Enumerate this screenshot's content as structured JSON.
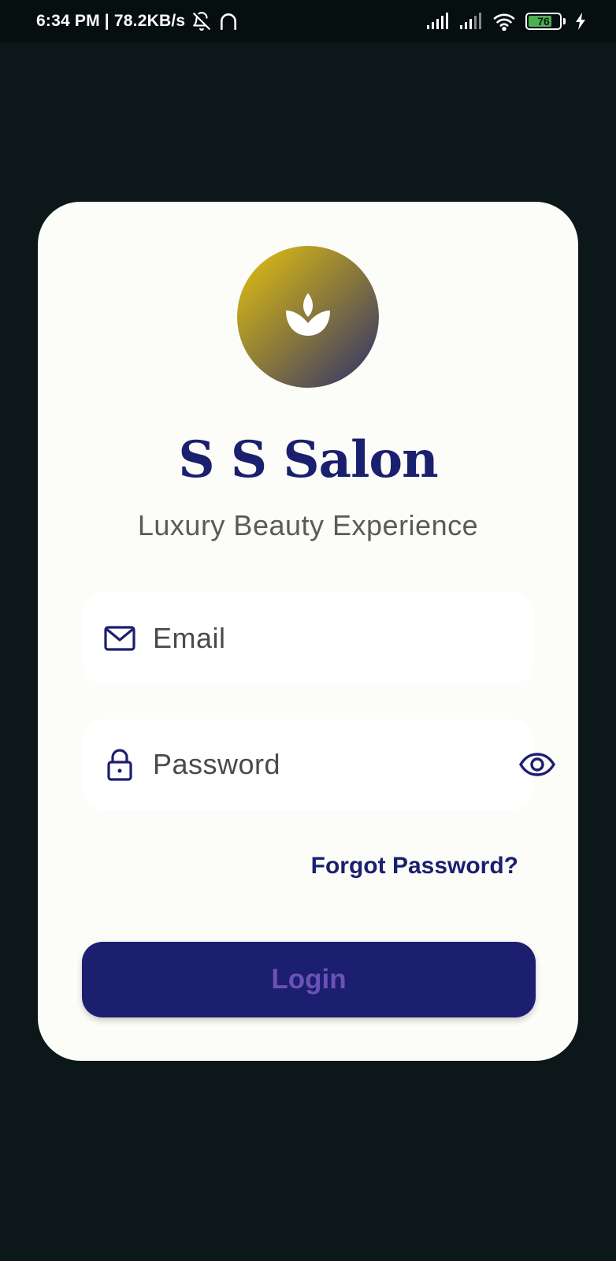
{
  "status_bar": {
    "time_speed": "6:34 PM | 78.2KB/s",
    "battery_level": "76",
    "icons": [
      "mute-notifications-icon",
      "headset-icon",
      "signal-icon",
      "signal-icon",
      "wifi-icon",
      "battery-icon",
      "charging-icon"
    ]
  },
  "brand": {
    "logo_icon": "lotus-icon",
    "title": "S S Salon",
    "subtitle": "Luxury Beauty Experience"
  },
  "form": {
    "email_placeholder": "Email",
    "email_icon": "mail-icon",
    "password_placeholder": "Password",
    "password_icon": "lock-icon",
    "toggle_icon": "eye-icon",
    "forgot_label": "Forgot Password?",
    "login_label": "Login"
  },
  "colors": {
    "background": "#0b1718",
    "card": "#fcfcf8",
    "primary": "#1c1e6f",
    "login_text": "#6a52b8",
    "gold": "#e5c310"
  }
}
